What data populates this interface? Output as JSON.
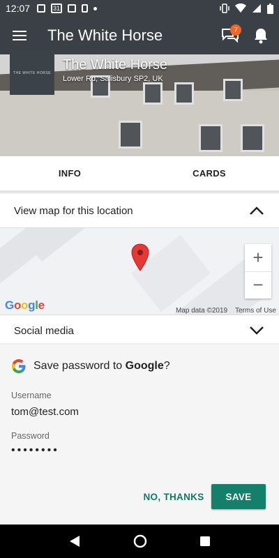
{
  "status_bar": {
    "time": "12:07",
    "calendar_day": "31"
  },
  "app_bar": {
    "title": "The White Horse",
    "messages_badge": "7"
  },
  "venue": {
    "name": "The White Horse",
    "address": "Lower Rd, Salisbury SP2, UK",
    "logo_text": "THE WHITE HORSE"
  },
  "tabs": [
    {
      "label": "INFO"
    },
    {
      "label": "CARDS"
    }
  ],
  "map_section": {
    "label": "View map for this location"
  },
  "map": {
    "zoom_in": "+",
    "zoom_out": "−",
    "google": [
      "G",
      "o",
      "o",
      "g",
      "l",
      "e"
    ],
    "attribution": "Map data ©2019",
    "terms": "Terms of Use"
  },
  "social_section": {
    "label": "Social media"
  },
  "save_password": {
    "title_prefix": "Save password to ",
    "title_brand": "Google",
    "title_suffix": "?",
    "username_label": "Username",
    "username_value": "tom@test.com",
    "password_label": "Password",
    "password_value": "••••••••",
    "no_thanks": "NO, THANKS",
    "save": "SAVE"
  },
  "colors": {
    "app_bar": "#3a4046",
    "accent": "#13806b",
    "badge": "#f26522",
    "pin": "#e53935"
  },
  "icons": [
    "menu-icon",
    "chat-icon",
    "bell-icon",
    "chevron-up-icon",
    "chevron-down-icon",
    "map-pin-icon",
    "google-g-icon",
    "back-icon",
    "home-icon",
    "recents-icon"
  ]
}
